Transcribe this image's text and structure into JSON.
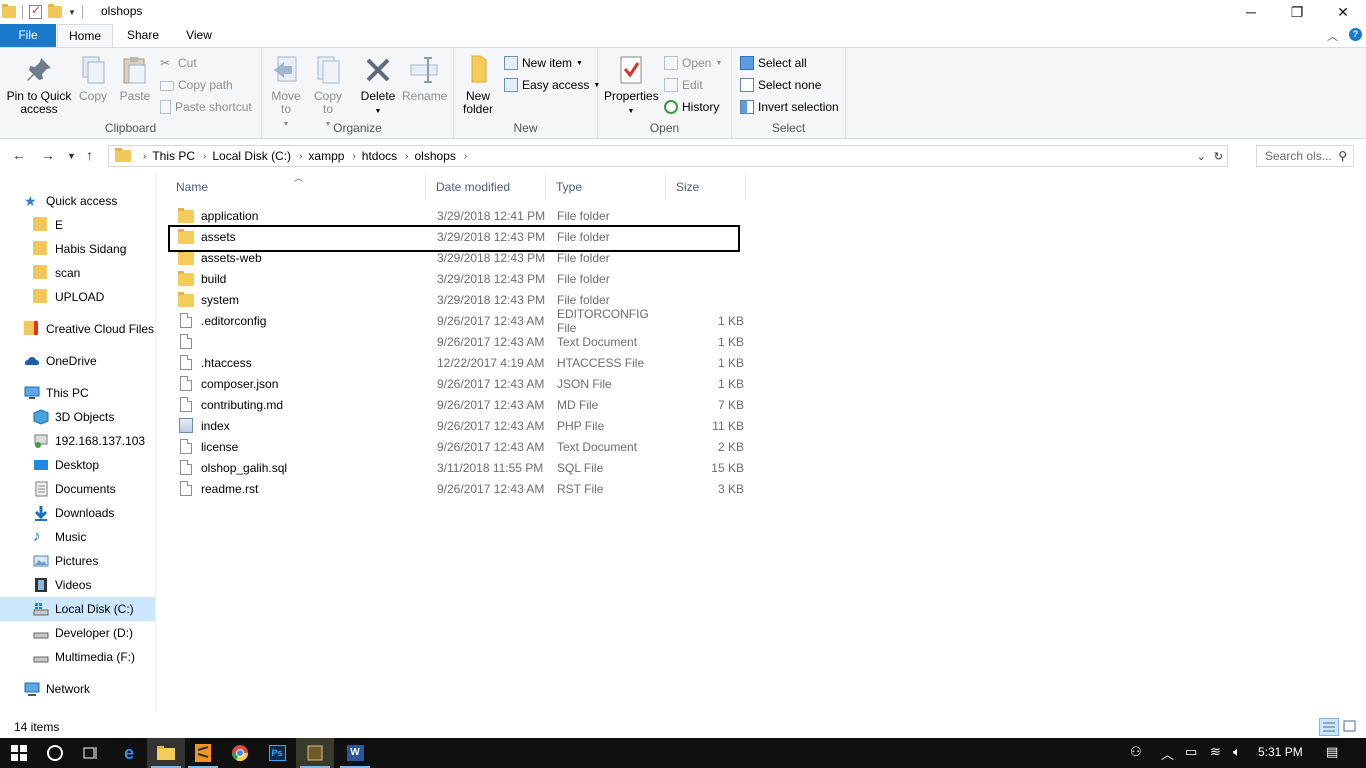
{
  "window": {
    "title": "olshops",
    "controls": {
      "minimize": "─",
      "maximize": "❐",
      "close": "✕"
    }
  },
  "ribbon_tabs": {
    "file": "File",
    "home": "Home",
    "share": "Share",
    "view": "View"
  },
  "ribbon": {
    "clipboard": {
      "label": "Clipboard",
      "pin": "Pin to Quick access",
      "copy": "Copy",
      "paste": "Paste",
      "cut": "Cut",
      "copy_path": "Copy path",
      "paste_shortcut": "Paste shortcut"
    },
    "organize": {
      "label": "Organize",
      "move_to": "Move to",
      "copy_to": "Copy to",
      "delete": "Delete",
      "rename": "Rename"
    },
    "new": {
      "label": "New",
      "new_folder": "New folder",
      "new_item": "New item",
      "easy_access": "Easy access"
    },
    "open": {
      "label": "Open",
      "properties": "Properties",
      "open": "Open",
      "edit": "Edit",
      "history": "History"
    },
    "select": {
      "label": "Select",
      "select_all": "Select all",
      "select_none": "Select none",
      "invert": "Invert selection"
    }
  },
  "address": {
    "crumbs": [
      "This PC",
      "Local Disk (C:)",
      "xampp",
      "htdocs",
      "olshops"
    ],
    "search_placeholder": "Search ols..."
  },
  "nav": {
    "quick_access": "Quick access",
    "quick_items": [
      "E",
      "Habis Sidang",
      "scan",
      "UPLOAD"
    ],
    "creative_cloud": "Creative Cloud Files",
    "onedrive": "OneDrive",
    "this_pc": "This PC",
    "pc_items": [
      "3D Objects",
      "192.168.137.103",
      "Desktop",
      "Documents",
      "Downloads",
      "Music",
      "Pictures",
      "Videos",
      "Local Disk (C:)",
      "Developer (D:)",
      "Multimedia (F:)"
    ],
    "network": "Network"
  },
  "columns": {
    "name": "Name",
    "date": "Date modified",
    "type": "Type",
    "size": "Size"
  },
  "files": [
    {
      "name": "application",
      "date": "3/29/2018 12:41 PM",
      "type": "File folder",
      "size": "",
      "kind": "folder"
    },
    {
      "name": "assets",
      "date": "3/29/2018 12:43 PM",
      "type": "File folder",
      "size": "",
      "kind": "folder"
    },
    {
      "name": "assets-web",
      "date": "3/29/2018 12:43 PM",
      "type": "File folder",
      "size": "",
      "kind": "folder"
    },
    {
      "name": "build",
      "date": "3/29/2018 12:43 PM",
      "type": "File folder",
      "size": "",
      "kind": "folder"
    },
    {
      "name": "system",
      "date": "3/29/2018 12:43 PM",
      "type": "File folder",
      "size": "",
      "kind": "folder"
    },
    {
      "name": ".editorconfig",
      "date": "9/26/2017 12:43 AM",
      "type": "EDITORCONFIG File",
      "size": "1 KB",
      "kind": "file"
    },
    {
      "name": "",
      "date": "9/26/2017 12:43 AM",
      "type": "Text Document",
      "size": "1 KB",
      "kind": "file"
    },
    {
      "name": ".htaccess",
      "date": "12/22/2017 4:19 AM",
      "type": "HTACCESS File",
      "size": "1 KB",
      "kind": "file"
    },
    {
      "name": "composer.json",
      "date": "9/26/2017 12:43 AM",
      "type": "JSON File",
      "size": "1 KB",
      "kind": "file"
    },
    {
      "name": "contributing.md",
      "date": "9/26/2017 12:43 AM",
      "type": "MD File",
      "size": "7 KB",
      "kind": "file"
    },
    {
      "name": "index",
      "date": "9/26/2017 12:43 AM",
      "type": "PHP File",
      "size": "11 KB",
      "kind": "php"
    },
    {
      "name": "license",
      "date": "9/26/2017 12:43 AM",
      "type": "Text Document",
      "size": "2 KB",
      "kind": "file"
    },
    {
      "name": "olshop_galih.sql",
      "date": "3/11/2018 11:55 PM",
      "type": "SQL File",
      "size": "15 KB",
      "kind": "file"
    },
    {
      "name": "readme.rst",
      "date": "9/26/2017 12:43 AM",
      "type": "RST File",
      "size": "3 KB",
      "kind": "file"
    }
  ],
  "status": {
    "items": "14 items"
  },
  "taskbar": {
    "clock": "5:31 PM"
  },
  "colors": {
    "accent": "#1979ca",
    "selected": "#cce8ff",
    "folder": "#f5cc5c"
  }
}
